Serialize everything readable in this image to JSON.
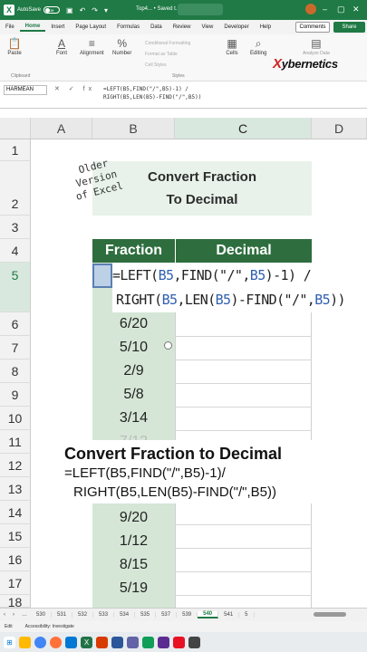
{
  "titlebar": {
    "autosave_label": "AutoSave",
    "autosave_state": "Off",
    "doc_name": "Top4... • Saved t..."
  },
  "menu": {
    "tabs": [
      "File",
      "Home",
      "Insert",
      "Page Layout",
      "Formulas",
      "Data",
      "Review",
      "View",
      "Developer",
      "Help"
    ],
    "active": "Home",
    "comments_label": "Comments",
    "share_label": "Share"
  },
  "ribbon": {
    "paste_label": "Paste",
    "font_label": "Font",
    "alignment_label": "Alignment",
    "number_label": "Number",
    "cells_label": "Cells",
    "editing_label": "Editing",
    "addins_label": "Analyze Data",
    "conditional_formatting": "Conditional Formatting",
    "format_as_table": "Format as Table",
    "cell_styles": "Cell Styles",
    "clipboard_group": "Clipboard",
    "styles_group": "Styles"
  },
  "brand": {
    "first_letter": "X",
    "rest": "ybernetics"
  },
  "formula_bar": {
    "name_box": "HARMEAN",
    "fx_icons": "✕ ✓ fx",
    "formula_line1": "=LEFT(B5,FIND(\"/\",B5)-1) /",
    "formula_line2": "RIGHT(B5,LEN(B5)-FIND(\"/\",B5))"
  },
  "columns": [
    {
      "label": "A",
      "selected": false
    },
    {
      "label": "B",
      "selected": false
    },
    {
      "label": "C",
      "selected": true
    },
    {
      "label": "D",
      "selected": false
    }
  ],
  "rows": [
    {
      "label": "1",
      "selected": false
    },
    {
      "label": "2",
      "selected": false
    },
    {
      "label": "3",
      "selected": false
    },
    {
      "label": "4",
      "selected": false
    },
    {
      "label": "5",
      "selected": true
    },
    {
      "label": "6",
      "selected": false
    },
    {
      "label": "7",
      "selected": false
    },
    {
      "label": "8",
      "selected": false
    },
    {
      "label": "9",
      "selected": false
    },
    {
      "label": "10",
      "selected": false
    },
    {
      "label": "11",
      "selected": false
    },
    {
      "label": "12",
      "selected": false
    },
    {
      "label": "13",
      "selected": false
    },
    {
      "label": "14",
      "selected": false
    },
    {
      "label": "15",
      "selected": false
    },
    {
      "label": "16",
      "selected": false
    },
    {
      "label": "17",
      "selected": false
    },
    {
      "label": "18",
      "selected": false
    }
  ],
  "sheet": {
    "stamp_lines": [
      "Older",
      "Version",
      "of Excel"
    ],
    "title_line1": "Convert Fraction",
    "title_line2": "To Decimal",
    "header_fraction": "Fraction",
    "header_decimal": "Decimal",
    "fractions": [
      "6/20",
      "5/10",
      "2/9",
      "5/8",
      "3/14",
      "7/12",
      "",
      "",
      "9/20",
      "1/12",
      "8/15",
      "5/19"
    ]
  },
  "edit": {
    "line1_a": "=LEFT(",
    "line1_ref1": "B5",
    "line1_b": ",FIND(\"/\",",
    "line1_ref2": "B5",
    "line1_c": ")-1) /",
    "line2_a": "RIGHT(",
    "line2_ref1": "B5",
    "line2_b": ",LEN(",
    "line2_ref2": "B5",
    "line2_c": ")-FIND(\"/\",",
    "line2_ref3": "B5",
    "line2_d": "))"
  },
  "overlay": {
    "title": "Convert Fraction to Decimal",
    "line1": "=LEFT(B5,FIND(\"/\",B5)-1)/",
    "line2": "RIGHT(B5,LEN(B5)-FIND(\"/\",B5))"
  },
  "sheet_tabs": {
    "tabs": [
      "530",
      "531",
      "532",
      "533",
      "534",
      "535",
      "537",
      "539",
      "540",
      "541",
      "5"
    ],
    "active": "540"
  },
  "status": {
    "mode": "Edit",
    "accessibility": "Accessibility: Investigate"
  }
}
